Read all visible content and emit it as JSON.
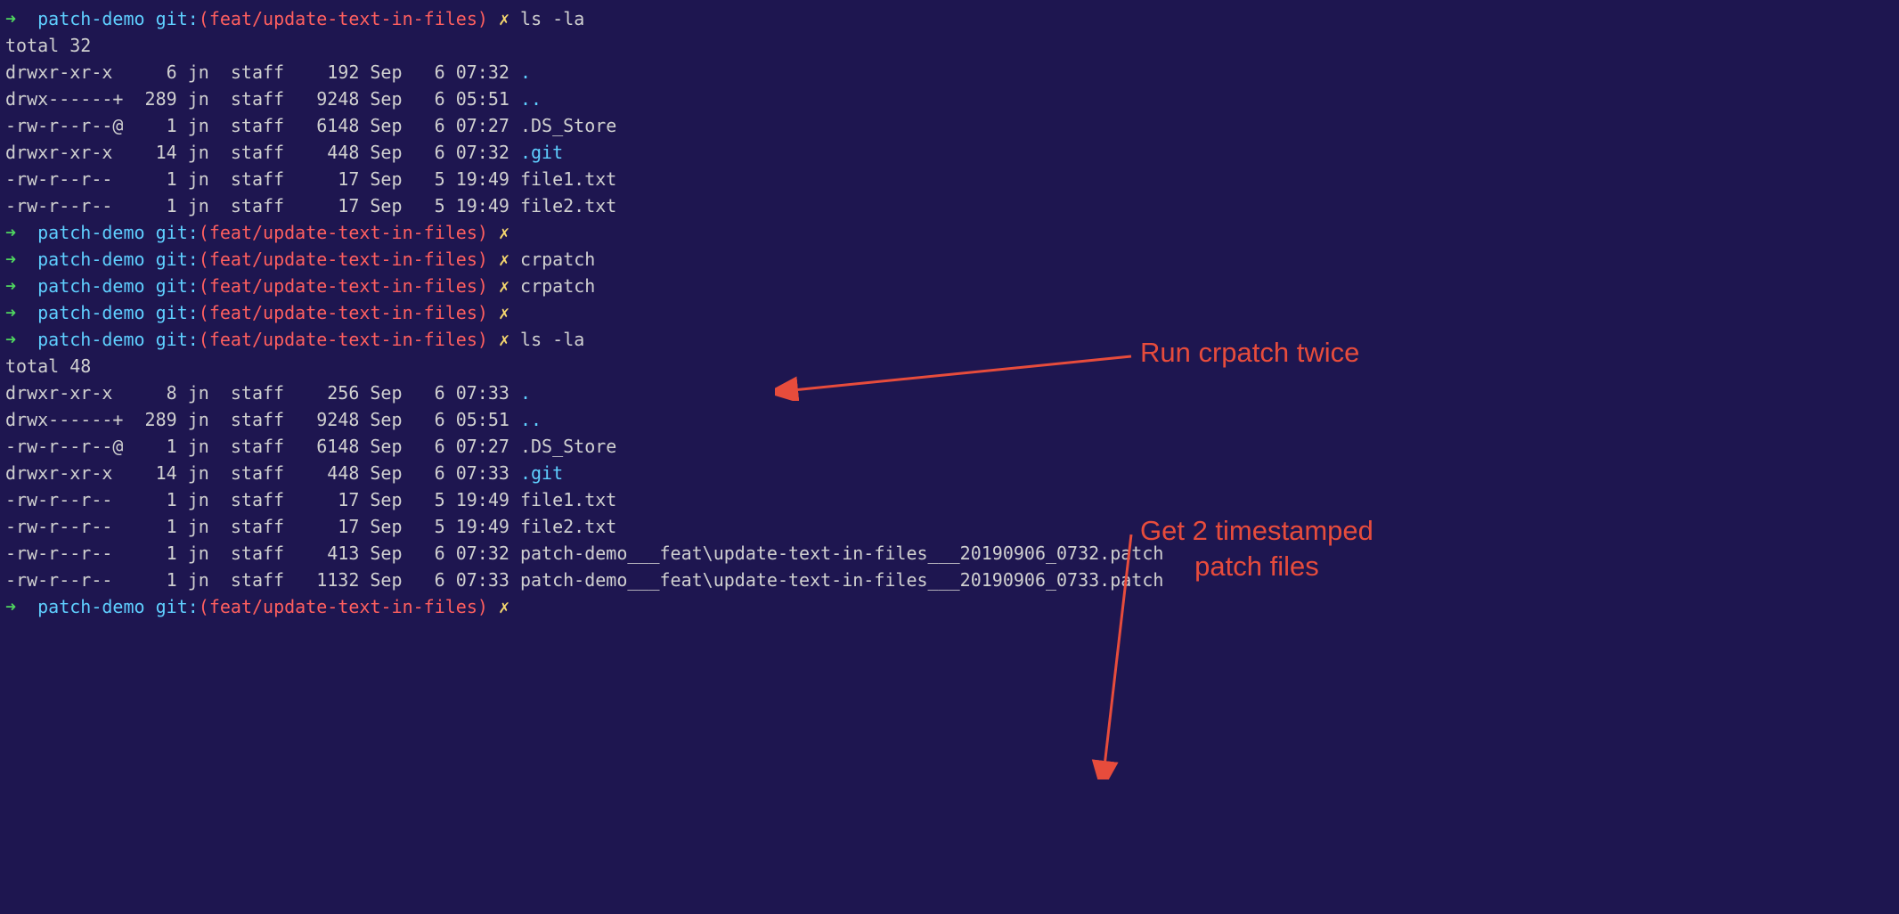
{
  "prompt": {
    "arrow": "➜",
    "dir": "patch-demo",
    "git_label": "git:",
    "paren_open": "(",
    "branch": "feat/update-text-in-files",
    "paren_close": ")",
    "x": "✗"
  },
  "commands": {
    "ls1": "ls -la",
    "empty": "",
    "crpatch": "crpatch",
    "ls2": "ls -la"
  },
  "listing1": {
    "total": "total 32",
    "rows": [
      {
        "perms": "drwxr-xr-x ",
        "links": "   6",
        "user": "jn",
        "group": "staff",
        "size": "  192",
        "month": "Sep",
        "day": " 6",
        "time": "07:32",
        "name": ".",
        "cyan": true
      },
      {
        "perms": "drwx------+",
        "links": " 289",
        "user": "jn",
        "group": "staff",
        "size": " 9248",
        "month": "Sep",
        "day": " 6",
        "time": "05:51",
        "name": "..",
        "cyan": true
      },
      {
        "perms": "-rw-r--r--@",
        "links": "   1",
        "user": "jn",
        "group": "staff",
        "size": " 6148",
        "month": "Sep",
        "day": " 6",
        "time": "07:27",
        "name": ".DS_Store",
        "cyan": false
      },
      {
        "perms": "drwxr-xr-x ",
        "links": "  14",
        "user": "jn",
        "group": "staff",
        "size": "  448",
        "month": "Sep",
        "day": " 6",
        "time": "07:32",
        "name": ".git",
        "cyan": true
      },
      {
        "perms": "-rw-r--r-- ",
        "links": "   1",
        "user": "jn",
        "group": "staff",
        "size": "   17",
        "month": "Sep",
        "day": " 5",
        "time": "19:49",
        "name": "file1.txt",
        "cyan": false
      },
      {
        "perms": "-rw-r--r-- ",
        "links": "   1",
        "user": "jn",
        "group": "staff",
        "size": "   17",
        "month": "Sep",
        "day": " 5",
        "time": "19:49",
        "name": "file2.txt",
        "cyan": false
      }
    ]
  },
  "listing2": {
    "total": "total 48",
    "rows": [
      {
        "perms": "drwxr-xr-x ",
        "links": "   8",
        "user": "jn",
        "group": "staff",
        "size": "  256",
        "month": "Sep",
        "day": " 6",
        "time": "07:33",
        "name": ".",
        "cyan": true
      },
      {
        "perms": "drwx------+",
        "links": " 289",
        "user": "jn",
        "group": "staff",
        "size": " 9248",
        "month": "Sep",
        "day": " 6",
        "time": "05:51",
        "name": "..",
        "cyan": true
      },
      {
        "perms": "-rw-r--r--@",
        "links": "   1",
        "user": "jn",
        "group": "staff",
        "size": " 6148",
        "month": "Sep",
        "day": " 6",
        "time": "07:27",
        "name": ".DS_Store",
        "cyan": false
      },
      {
        "perms": "drwxr-xr-x ",
        "links": "  14",
        "user": "jn",
        "group": "staff",
        "size": "  448",
        "month": "Sep",
        "day": " 6",
        "time": "07:33",
        "name": ".git",
        "cyan": true
      },
      {
        "perms": "-rw-r--r-- ",
        "links": "   1",
        "user": "jn",
        "group": "staff",
        "size": "   17",
        "month": "Sep",
        "day": " 5",
        "time": "19:49",
        "name": "file1.txt",
        "cyan": false
      },
      {
        "perms": "-rw-r--r-- ",
        "links": "   1",
        "user": "jn",
        "group": "staff",
        "size": "   17",
        "month": "Sep",
        "day": " 5",
        "time": "19:49",
        "name": "file2.txt",
        "cyan": false
      },
      {
        "perms": "-rw-r--r-- ",
        "links": "   1",
        "user": "jn",
        "group": "staff",
        "size": "  413",
        "month": "Sep",
        "day": " 6",
        "time": "07:32",
        "name": "patch-demo___feat\\update-text-in-files___20190906_0732.patch",
        "cyan": false
      },
      {
        "perms": "-rw-r--r-- ",
        "links": "   1",
        "user": "jn",
        "group": "staff",
        "size": " 1132",
        "month": "Sep",
        "day": " 6",
        "time": "07:33",
        "name": "patch-demo___feat\\update-text-in-files___20190906_0733.patch",
        "cyan": false
      }
    ]
  },
  "annotations": {
    "a1": "Run crpatch twice",
    "a2_line1": "Get 2 timestamped",
    "a2_line2": "patch files"
  }
}
